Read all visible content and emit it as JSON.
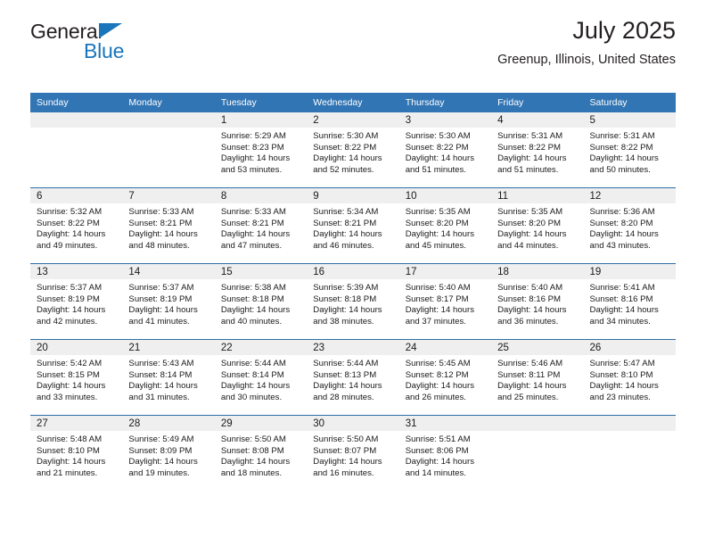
{
  "brand": {
    "name_part1": "General",
    "name_part2": "Blue",
    "accent_color": "#1b75bb"
  },
  "header": {
    "title": "July 2025",
    "location": "Greenup, Illinois, United States",
    "header_bg": "#3275b4"
  },
  "weekdays": [
    "Sunday",
    "Monday",
    "Tuesday",
    "Wednesday",
    "Thursday",
    "Friday",
    "Saturday"
  ],
  "weeks": [
    [
      {
        "day": "",
        "lines": []
      },
      {
        "day": "",
        "lines": []
      },
      {
        "day": "1",
        "lines": [
          "Sunrise: 5:29 AM",
          "Sunset: 8:23 PM",
          "Daylight: 14 hours",
          "and 53 minutes."
        ]
      },
      {
        "day": "2",
        "lines": [
          "Sunrise: 5:30 AM",
          "Sunset: 8:22 PM",
          "Daylight: 14 hours",
          "and 52 minutes."
        ]
      },
      {
        "day": "3",
        "lines": [
          "Sunrise: 5:30 AM",
          "Sunset: 8:22 PM",
          "Daylight: 14 hours",
          "and 51 minutes."
        ]
      },
      {
        "day": "4",
        "lines": [
          "Sunrise: 5:31 AM",
          "Sunset: 8:22 PM",
          "Daylight: 14 hours",
          "and 51 minutes."
        ]
      },
      {
        "day": "5",
        "lines": [
          "Sunrise: 5:31 AM",
          "Sunset: 8:22 PM",
          "Daylight: 14 hours",
          "and 50 minutes."
        ]
      }
    ],
    [
      {
        "day": "6",
        "lines": [
          "Sunrise: 5:32 AM",
          "Sunset: 8:22 PM",
          "Daylight: 14 hours",
          "and 49 minutes."
        ]
      },
      {
        "day": "7",
        "lines": [
          "Sunrise: 5:33 AM",
          "Sunset: 8:21 PM",
          "Daylight: 14 hours",
          "and 48 minutes."
        ]
      },
      {
        "day": "8",
        "lines": [
          "Sunrise: 5:33 AM",
          "Sunset: 8:21 PM",
          "Daylight: 14 hours",
          "and 47 minutes."
        ]
      },
      {
        "day": "9",
        "lines": [
          "Sunrise: 5:34 AM",
          "Sunset: 8:21 PM",
          "Daylight: 14 hours",
          "and 46 minutes."
        ]
      },
      {
        "day": "10",
        "lines": [
          "Sunrise: 5:35 AM",
          "Sunset: 8:20 PM",
          "Daylight: 14 hours",
          "and 45 minutes."
        ]
      },
      {
        "day": "11",
        "lines": [
          "Sunrise: 5:35 AM",
          "Sunset: 8:20 PM",
          "Daylight: 14 hours",
          "and 44 minutes."
        ]
      },
      {
        "day": "12",
        "lines": [
          "Sunrise: 5:36 AM",
          "Sunset: 8:20 PM",
          "Daylight: 14 hours",
          "and 43 minutes."
        ]
      }
    ],
    [
      {
        "day": "13",
        "lines": [
          "Sunrise: 5:37 AM",
          "Sunset: 8:19 PM",
          "Daylight: 14 hours",
          "and 42 minutes."
        ]
      },
      {
        "day": "14",
        "lines": [
          "Sunrise: 5:37 AM",
          "Sunset: 8:19 PM",
          "Daylight: 14 hours",
          "and 41 minutes."
        ]
      },
      {
        "day": "15",
        "lines": [
          "Sunrise: 5:38 AM",
          "Sunset: 8:18 PM",
          "Daylight: 14 hours",
          "and 40 minutes."
        ]
      },
      {
        "day": "16",
        "lines": [
          "Sunrise: 5:39 AM",
          "Sunset: 8:18 PM",
          "Daylight: 14 hours",
          "and 38 minutes."
        ]
      },
      {
        "day": "17",
        "lines": [
          "Sunrise: 5:40 AM",
          "Sunset: 8:17 PM",
          "Daylight: 14 hours",
          "and 37 minutes."
        ]
      },
      {
        "day": "18",
        "lines": [
          "Sunrise: 5:40 AM",
          "Sunset: 8:16 PM",
          "Daylight: 14 hours",
          "and 36 minutes."
        ]
      },
      {
        "day": "19",
        "lines": [
          "Sunrise: 5:41 AM",
          "Sunset: 8:16 PM",
          "Daylight: 14 hours",
          "and 34 minutes."
        ]
      }
    ],
    [
      {
        "day": "20",
        "lines": [
          "Sunrise: 5:42 AM",
          "Sunset: 8:15 PM",
          "Daylight: 14 hours",
          "and 33 minutes."
        ]
      },
      {
        "day": "21",
        "lines": [
          "Sunrise: 5:43 AM",
          "Sunset: 8:14 PM",
          "Daylight: 14 hours",
          "and 31 minutes."
        ]
      },
      {
        "day": "22",
        "lines": [
          "Sunrise: 5:44 AM",
          "Sunset: 8:14 PM",
          "Daylight: 14 hours",
          "and 30 minutes."
        ]
      },
      {
        "day": "23",
        "lines": [
          "Sunrise: 5:44 AM",
          "Sunset: 8:13 PM",
          "Daylight: 14 hours",
          "and 28 minutes."
        ]
      },
      {
        "day": "24",
        "lines": [
          "Sunrise: 5:45 AM",
          "Sunset: 8:12 PM",
          "Daylight: 14 hours",
          "and 26 minutes."
        ]
      },
      {
        "day": "25",
        "lines": [
          "Sunrise: 5:46 AM",
          "Sunset: 8:11 PM",
          "Daylight: 14 hours",
          "and 25 minutes."
        ]
      },
      {
        "day": "26",
        "lines": [
          "Sunrise: 5:47 AM",
          "Sunset: 8:10 PM",
          "Daylight: 14 hours",
          "and 23 minutes."
        ]
      }
    ],
    [
      {
        "day": "27",
        "lines": [
          "Sunrise: 5:48 AM",
          "Sunset: 8:10 PM",
          "Daylight: 14 hours",
          "and 21 minutes."
        ]
      },
      {
        "day": "28",
        "lines": [
          "Sunrise: 5:49 AM",
          "Sunset: 8:09 PM",
          "Daylight: 14 hours",
          "and 19 minutes."
        ]
      },
      {
        "day": "29",
        "lines": [
          "Sunrise: 5:50 AM",
          "Sunset: 8:08 PM",
          "Daylight: 14 hours",
          "and 18 minutes."
        ]
      },
      {
        "day": "30",
        "lines": [
          "Sunrise: 5:50 AM",
          "Sunset: 8:07 PM",
          "Daylight: 14 hours",
          "and 16 minutes."
        ]
      },
      {
        "day": "31",
        "lines": [
          "Sunrise: 5:51 AM",
          "Sunset: 8:06 PM",
          "Daylight: 14 hours",
          "and 14 minutes."
        ]
      },
      {
        "day": "",
        "lines": []
      },
      {
        "day": "",
        "lines": []
      }
    ]
  ]
}
